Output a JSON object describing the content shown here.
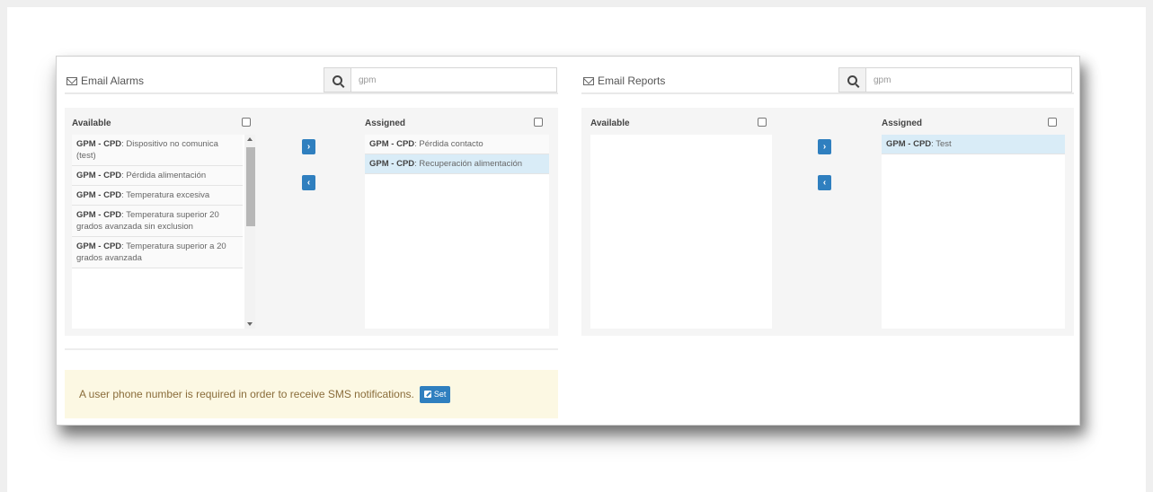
{
  "alarms": {
    "title": "Email Alarms",
    "search_value": "gpm",
    "available_label": "Available",
    "assigned_label": "Assigned",
    "available_items": [
      {
        "prefix": "GPM - CPD",
        "text": ": Dispositivo no comunica (test)"
      },
      {
        "prefix": "GPM - CPD",
        "text": ": Pérdida alimentación"
      },
      {
        "prefix": "GPM - CPD",
        "text": ": Temperatura excesiva"
      },
      {
        "prefix": "GPM - CPD",
        "text": ": Temperatura superior 20 grados avanzada sin exclusion"
      },
      {
        "prefix": "GPM - CPD",
        "text": ": Temperatura superior a 20 grados avanzada"
      }
    ],
    "assigned_items": [
      {
        "prefix": "GPM - CPD",
        "text": ": Pérdida contacto"
      },
      {
        "prefix": "GPM - CPD",
        "text": ": Recuperación alimentación"
      }
    ],
    "move_right": "›",
    "move_left": "‹"
  },
  "reports": {
    "title": "Email Reports",
    "search_value": "gpm",
    "available_label": "Available",
    "assigned_label": "Assigned",
    "assigned_items": [
      {
        "prefix": "GPM - CPD",
        "text": ": Test"
      }
    ],
    "move_right": "›",
    "move_left": "‹"
  },
  "sms": {
    "message": "A user phone number is required in order to receive SMS notifications.",
    "set_label": "Set"
  },
  "colors": {
    "accent": "#2f7fbf",
    "selected_row": "#d9ecf7",
    "warning_bg": "#fcf8e3"
  }
}
